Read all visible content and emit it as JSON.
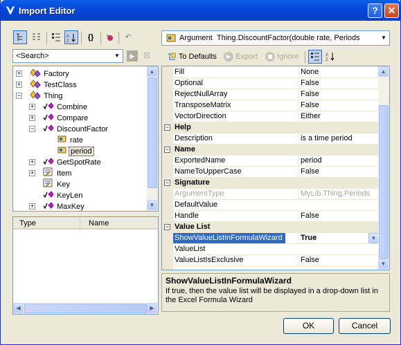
{
  "window": {
    "title": "Import Editor",
    "help_glyph": "?",
    "close_glyph": "✕"
  },
  "left_toolbar": {
    "search_placeholder": "<Search>"
  },
  "tree": {
    "items": [
      {
        "label": "Factory",
        "level": 1,
        "expander": "+",
        "icon": "class-icon"
      },
      {
        "label": "TestClass",
        "level": 1,
        "expander": "+",
        "icon": "class-icon"
      },
      {
        "label": "Thing",
        "level": 1,
        "expander": "-",
        "icon": "class-icon"
      },
      {
        "label": "Combine",
        "level": 2,
        "expander": "+",
        "icon": "method-icon"
      },
      {
        "label": "Compare",
        "level": 2,
        "expander": "+",
        "icon": "method-icon"
      },
      {
        "label": "DiscountFactor",
        "level": 2,
        "expander": "-",
        "icon": "method-icon"
      },
      {
        "label": "rate",
        "level": 3,
        "expander": "",
        "icon": "parameter-icon"
      },
      {
        "label": "period",
        "level": 3,
        "expander": "",
        "icon": "parameter-icon",
        "selected": true
      },
      {
        "label": "GetSpotRate",
        "level": 2,
        "expander": "+",
        "icon": "method-icon"
      },
      {
        "label": "Item",
        "level": 2,
        "expander": "+",
        "icon": "property-icon"
      },
      {
        "label": "Key",
        "level": 2,
        "expander": "",
        "icon": "property-icon"
      },
      {
        "label": "KeyLen",
        "level": 2,
        "expander": "",
        "icon": "method-icon"
      },
      {
        "label": "MaxKey",
        "level": 2,
        "expander": "+",
        "icon": "method-icon"
      }
    ]
  },
  "list": {
    "col_type": "Type",
    "col_name": "Name"
  },
  "right_header": {
    "prefix": "Argument",
    "signature": "Thing.DiscountFactor(double rate, Periods"
  },
  "right_toolbar": {
    "to_defaults": "To Defaults",
    "export": "Export",
    "ignore": "Ignore"
  },
  "grid": {
    "rows": [
      {
        "kind": "row",
        "key": "Fill",
        "value": "None"
      },
      {
        "kind": "row",
        "key": "Optional",
        "value": "False"
      },
      {
        "kind": "row",
        "key": "RejectNullArray",
        "value": "False"
      },
      {
        "kind": "row",
        "key": "TransposeMatrix",
        "value": "False"
      },
      {
        "kind": "row",
        "key": "VectorDirection",
        "value": "Either"
      },
      {
        "kind": "cat",
        "key": "Help"
      },
      {
        "kind": "row",
        "key": "Description",
        "value": "is a time period"
      },
      {
        "kind": "cat",
        "key": "Name"
      },
      {
        "kind": "row",
        "key": "ExportedName",
        "value": "period"
      },
      {
        "kind": "row",
        "key": "NameToUpperCase",
        "value": "False"
      },
      {
        "kind": "cat",
        "key": "Signature"
      },
      {
        "kind": "row",
        "key": "ArgumentType",
        "value": "MyLib.Thing.Periods",
        "disabled": true
      },
      {
        "kind": "row",
        "key": "DefaultValue",
        "value": ""
      },
      {
        "kind": "row",
        "key": "Handle",
        "value": "False"
      },
      {
        "kind": "cat",
        "key": "Value List"
      },
      {
        "kind": "row",
        "key": "ShowValueListInFormulaWizard",
        "value": "True",
        "selected": true
      },
      {
        "kind": "row",
        "key": "ValueList",
        "value": ""
      },
      {
        "kind": "row",
        "key": "ValueListIsExclusive",
        "value": "False"
      }
    ]
  },
  "help": {
    "title": "ShowValueListInFormulaWizard",
    "text": "If true, then the value list will be displayed in a drop-down list in the Excel Formula Wizard"
  },
  "buttons": {
    "ok": "OK",
    "cancel": "Cancel"
  }
}
